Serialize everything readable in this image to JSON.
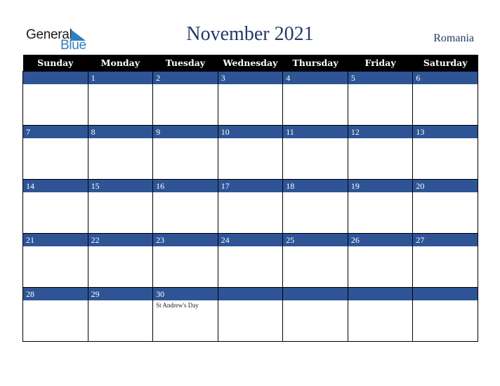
{
  "logo": {
    "line1": "General",
    "line2": "Blue",
    "icon": "triangle-flag-icon"
  },
  "title": "November 2021",
  "country": "Romania",
  "colors": {
    "header_bg": "#000000",
    "date_bar": "#2f5496",
    "title": "#233a66",
    "logo_blue": "#2f7fc1"
  },
  "weekdays": [
    "Sunday",
    "Monday",
    "Tuesday",
    "Wednesday",
    "Thursday",
    "Friday",
    "Saturday"
  ],
  "weeks": [
    [
      {
        "day": ""
      },
      {
        "day": "1"
      },
      {
        "day": "2"
      },
      {
        "day": "3"
      },
      {
        "day": "4"
      },
      {
        "day": "5"
      },
      {
        "day": "6"
      }
    ],
    [
      {
        "day": "7"
      },
      {
        "day": "8"
      },
      {
        "day": "9"
      },
      {
        "day": "10"
      },
      {
        "day": "11"
      },
      {
        "day": "12"
      },
      {
        "day": "13"
      }
    ],
    [
      {
        "day": "14"
      },
      {
        "day": "15"
      },
      {
        "day": "16"
      },
      {
        "day": "17"
      },
      {
        "day": "18"
      },
      {
        "day": "19"
      },
      {
        "day": "20"
      }
    ],
    [
      {
        "day": "21"
      },
      {
        "day": "22"
      },
      {
        "day": "23"
      },
      {
        "day": "24"
      },
      {
        "day": "25"
      },
      {
        "day": "26"
      },
      {
        "day": "27"
      }
    ],
    [
      {
        "day": "28"
      },
      {
        "day": "29"
      },
      {
        "day": "30",
        "event": "St Andrew's Day"
      },
      {
        "day": ""
      },
      {
        "day": ""
      },
      {
        "day": ""
      },
      {
        "day": ""
      }
    ]
  ]
}
